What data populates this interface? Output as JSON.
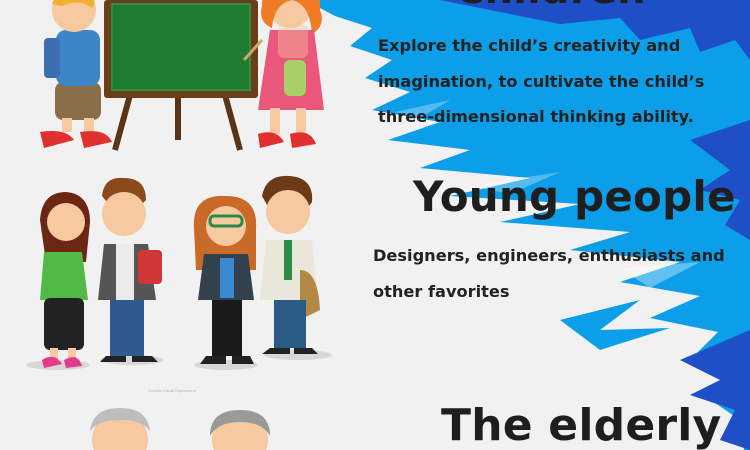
{
  "sections": {
    "children": {
      "heading": "Children",
      "description": "Explore the child’s creativity and imagination, to cultivate the child’s three-dimensional thinking ability."
    },
    "young_people": {
      "heading": "Young people",
      "description": "Designers, engineers, enthusiasts and other favorites"
    },
    "elderly": {
      "heading": "The elderly"
    }
  },
  "illustration_credit": "Graphic Visual Department",
  "colors": {
    "background": "#f1f1f1",
    "brush_blue": "#0c9ee8",
    "brush_dark_blue": "#1f4fc6",
    "heading_text": "#1e1e1e"
  }
}
